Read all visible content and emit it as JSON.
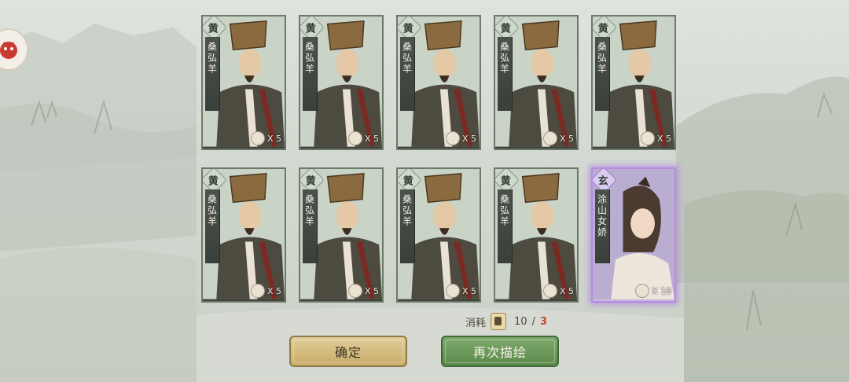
{
  "cards": [
    {
      "rank": "黄",
      "name": "桑弘羊",
      "count": "X 5",
      "tier": "normal"
    },
    {
      "rank": "黄",
      "name": "桑弘羊",
      "count": "X 5",
      "tier": "normal"
    },
    {
      "rank": "黄",
      "name": "桑弘羊",
      "count": "X 5",
      "tier": "normal"
    },
    {
      "rank": "黄",
      "name": "桑弘羊",
      "count": "X 5",
      "tier": "normal"
    },
    {
      "rank": "黄",
      "name": "桑弘羊",
      "count": "X 5",
      "tier": "normal"
    },
    {
      "rank": "黄",
      "name": "桑弘羊",
      "count": "X 5",
      "tier": "normal"
    },
    {
      "rank": "黄",
      "name": "桑弘羊",
      "count": "X 5",
      "tier": "normal"
    },
    {
      "rank": "黄",
      "name": "桑弘羊",
      "count": "X 5",
      "tier": "normal"
    },
    {
      "rank": "黄",
      "name": "桑弘羊",
      "count": "X 5",
      "tier": "normal"
    },
    {
      "rank": "玄",
      "name": "涂山女娇",
      "count": "X 10",
      "tier": "purple"
    }
  ],
  "cost": {
    "label": "消耗",
    "have": "10",
    "separator": "/",
    "need": "3",
    "token_icon": "scroll-token-icon"
  },
  "buttons": {
    "confirm": "确定",
    "again": "再次描绘"
  },
  "colors": {
    "confirm": "#d6c082",
    "again": "#6e9a5c",
    "purple_glow": "#b58de0",
    "need": "#c24a2c"
  }
}
